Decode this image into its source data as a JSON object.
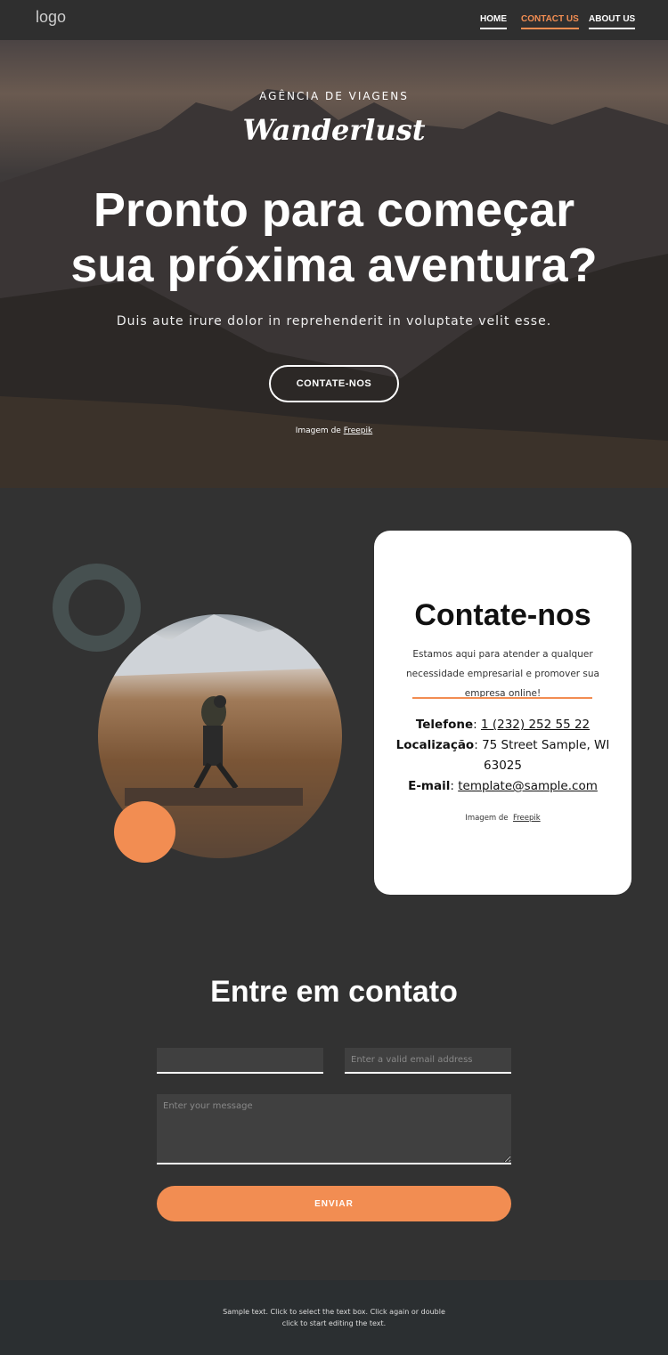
{
  "nav": {
    "logo": "logo",
    "items": [
      {
        "label": "HOME"
      },
      {
        "label": "CONTACT US",
        "active": true
      },
      {
        "label": "ABOUT US"
      }
    ]
  },
  "hero": {
    "kicker": "AGÊNCIA DE VIAGENS",
    "brand": "Wanderlust",
    "title_line1": "Pronto para começar",
    "title_line2": "sua próxima aventura?",
    "subtitle": "Duis aute irure dolor in reprehenderit in voluptate velit esse.",
    "cta": "CONTATE-NOS",
    "credit_prefix": "Imagem de",
    "credit_link": "Freepik"
  },
  "contact_card": {
    "title": "Contate-nos",
    "description": "Estamos aqui para atender a qualquer necessidade empresarial e promover sua empresa online!",
    "phone_label": "Telefone",
    "phone": "1 (232) 252 55 22",
    "location_label": "Localização",
    "location": "75 Street Sample, WI 63025",
    "email_label": "E-mail",
    "email": "template@sample.com",
    "credit_prefix": "Imagem de",
    "credit_link": "Freepik"
  },
  "form": {
    "title": "Entre em contato",
    "name_placeholder": "",
    "email_placeholder": "Enter a valid email address",
    "message_placeholder": "Enter your message",
    "submit": "ENVIAR"
  },
  "footer": {
    "text": "Sample text. Click to select the text box. Click again or double click to start editing the text."
  },
  "colors": {
    "accent": "#f28d52",
    "background": "#323232",
    "footer": "#2b2f31",
    "ring": "#465050"
  }
}
